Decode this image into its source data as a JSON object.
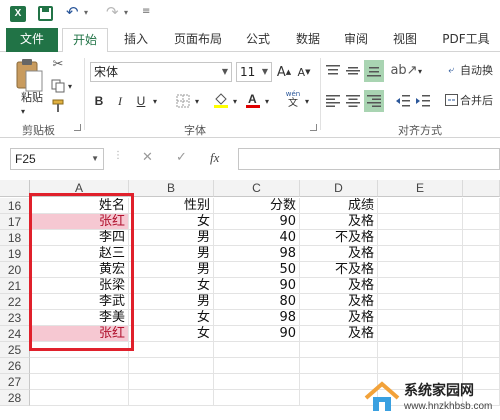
{
  "app": {
    "logo": "X"
  },
  "tabs": [
    "文件",
    "开始",
    "插入",
    "页面布局",
    "公式",
    "数据",
    "审阅",
    "视图",
    "PDF工具"
  ],
  "ribbon": {
    "clipboard": {
      "paste_label": "粘贴",
      "group_label": "剪贴板"
    },
    "font": {
      "name": "宋体",
      "size": "11",
      "grow": "A",
      "shrink": "A",
      "bold": "B",
      "italic": "I",
      "underline": "U",
      "wen": "wén",
      "group_label": "字体"
    },
    "alignment": {
      "wrap_text": "自动换",
      "merge": "合并后",
      "group_label": "对齐方式"
    }
  },
  "formula_bar": {
    "name_box": "F25",
    "fx": "fx",
    "formula": ""
  },
  "columns": [
    "A",
    "B",
    "C",
    "D",
    "E"
  ],
  "rows": [
    {
      "n": "16",
      "a": "姓名",
      "b": "性别",
      "c": "分数",
      "d": "成绩",
      "hl": false
    },
    {
      "n": "17",
      "a": "张红",
      "b": "女",
      "c": "90",
      "d": "及格",
      "hl": true
    },
    {
      "n": "18",
      "a": "李四",
      "b": "男",
      "c": "40",
      "d": "不及格",
      "hl": false
    },
    {
      "n": "19",
      "a": "赵三",
      "b": "男",
      "c": "98",
      "d": "及格",
      "hl": false
    },
    {
      "n": "20",
      "a": "黄宏",
      "b": "男",
      "c": "50",
      "d": "不及格",
      "hl": false
    },
    {
      "n": "21",
      "a": "张梁",
      "b": "女",
      "c": "90",
      "d": "及格",
      "hl": false
    },
    {
      "n": "22",
      "a": "李武",
      "b": "男",
      "c": "80",
      "d": "及格",
      "hl": false
    },
    {
      "n": "23",
      "a": "李美",
      "b": "女",
      "c": "98",
      "d": "及格",
      "hl": false
    },
    {
      "n": "24",
      "a": "张红",
      "b": "女",
      "c": "90",
      "d": "及格",
      "hl": true
    },
    {
      "n": "25",
      "a": "",
      "b": "",
      "c": "",
      "d": "",
      "hl": false
    },
    {
      "n": "26",
      "a": "",
      "b": "",
      "c": "",
      "d": "",
      "hl": false
    },
    {
      "n": "27",
      "a": "",
      "b": "",
      "c": "",
      "d": "",
      "hl": false
    },
    {
      "n": "28",
      "a": "",
      "b": "",
      "c": "",
      "d": "",
      "hl": false
    }
  ],
  "watermark": {
    "title": "系统家园网",
    "url": "www.hnzkhbsb.com"
  },
  "colors": {
    "accent": "#217346",
    "highlight_fill": "#f6c8d2",
    "highlight_text": "#b0112d",
    "selection_border": "#e0202b"
  }
}
